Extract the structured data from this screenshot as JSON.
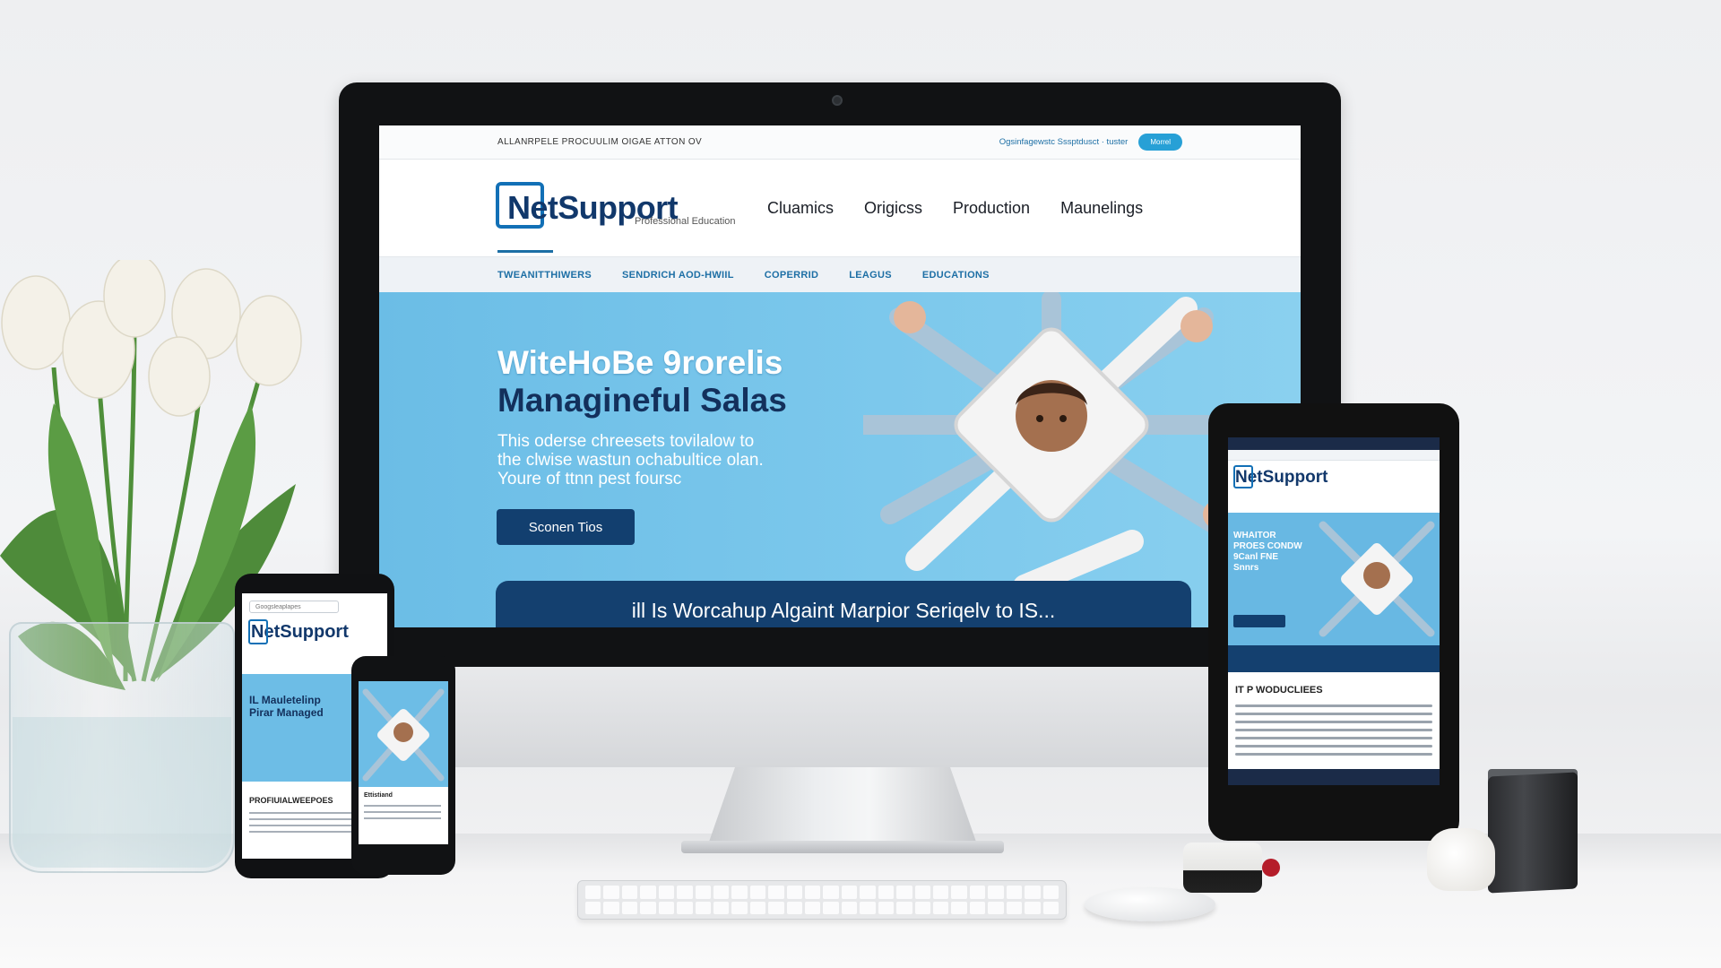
{
  "site": {
    "topbar_text": "ALLANRPELE PROCUULIM OIGAE ATTON OV",
    "topbar_link": "Ogsinfagewstc Sssptdusct · tuster",
    "topbar_button": "Morrel",
    "logo_text": "NetSupport",
    "logo_sub": "Professional Education",
    "nav": [
      "Cluamics",
      "Origicss",
      "Production",
      "Maunelings"
    ],
    "subnav": [
      "TWEANITTHIWERS",
      "SENDRICH AOD-HWIIL",
      "COPERRID",
      "LEAGUS",
      "EDUCATIONS"
    ]
  },
  "hero": {
    "title_line1": "WiteHoBe 9rorelis",
    "title_line2": "Managineful Salas",
    "desc_line1": "This oderse chreesets tovilalow to",
    "desc_line2": "the clwise wastun ochabultice olan.",
    "desc_line3": "Youre of ttnn pest foursc",
    "cta": "Sconen Tios",
    "banner": "ill Is Worcahup Algaint Marpior Seriqelv to IS..."
  },
  "tablet": {
    "logo": "NetSupport",
    "hero_title": "WHAITOR PROES CONDW 9Canl FNE Snnrs",
    "heading": "IT P WODUCLIEES"
  },
  "phone_large": {
    "search_placeholder": "Googsleaplapes",
    "logo": "NetSupport",
    "hero_title": "IL Mauletelinp Pirar Managed",
    "heading": "PROFIUIALWEEPOES"
  },
  "phone_small": {
    "heading": "Ettistiand"
  },
  "colors": {
    "brand_navy": "#12386b",
    "brand_blue": "#1270b6",
    "hero_sky": "#6ec1e8",
    "banner_navy": "#14406f"
  },
  "icons": [
    "tulip-flowers-icon",
    "camera-icon",
    "keyboard-icon",
    "mouse-icon",
    "speaker-icon"
  ]
}
